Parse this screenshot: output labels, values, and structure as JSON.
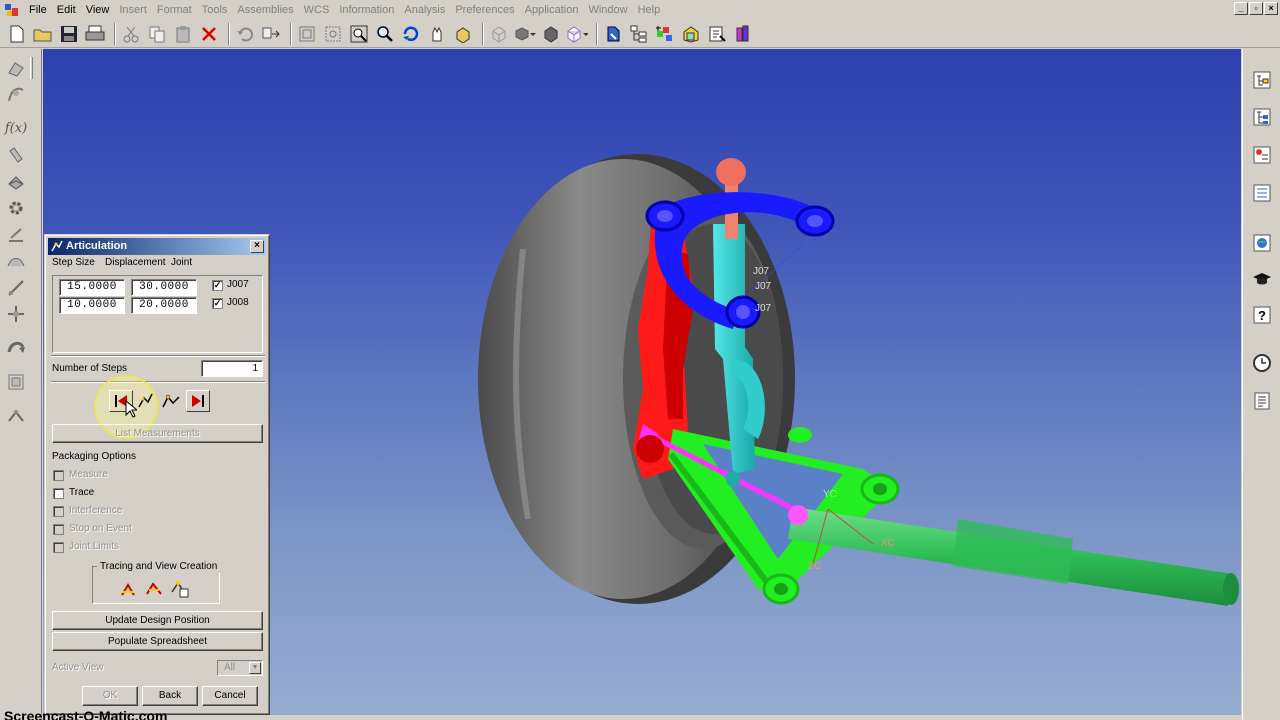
{
  "menu": [
    "File",
    "Edit",
    "View",
    "Insert",
    "Format",
    "Tools",
    "Assemblies",
    "WCS",
    "Information",
    "Analysis",
    "Preferences",
    "Application",
    "Window",
    "Help"
  ],
  "window_controls": [
    "_",
    "▫",
    "×"
  ],
  "dialog": {
    "title": "Articulation",
    "close": "×",
    "tabs": {
      "step_size": "Step Size",
      "displacement": "Displacement",
      "joint": "Joint"
    },
    "rows": [
      {
        "step": "15.0000",
        "displacement": "30.0000",
        "joint": "J007",
        "checked": "✓"
      },
      {
        "step": "10.0000",
        "displacement": "20.0000",
        "joint": "J008",
        "checked": "✓"
      }
    ],
    "number_of_steps_label": "Number of Steps",
    "number_of_steps": "1",
    "list_measurements": "List Measurements",
    "packaging_options": "Packaging Options",
    "options": [
      {
        "label": "Measure",
        "enabled": false
      },
      {
        "label": "Trace",
        "enabled": true
      },
      {
        "label": "Interference",
        "enabled": false
      },
      {
        "label": "Stop on Event",
        "enabled": false
      },
      {
        "label": "Joint Limits",
        "enabled": false
      }
    ],
    "tracing_group": "Tracing and View Creation",
    "update_design": "Update Design Position",
    "populate_spreadsheet": "Populate Spreadsheet",
    "active_view_label": "Active View",
    "active_view_value": "All",
    "ok": "OK",
    "back": "Back",
    "cancel": "Cancel"
  },
  "viewport": {
    "labels": [
      "J07",
      "J07",
      "J07",
      "YC",
      "XC",
      "ZC"
    ]
  },
  "watermark": "Screencast-O-Matic.com",
  "colors": {
    "tire": "#6e6e6e",
    "caliper": "#ff1a1a",
    "spring_perch": "#1a1aff",
    "strut": "#33cccc",
    "control_arm": "#22ee22",
    "tie_rod": "#ff33ff",
    "axle": "#2ecc5a",
    "title_bar": "#0a246a"
  }
}
